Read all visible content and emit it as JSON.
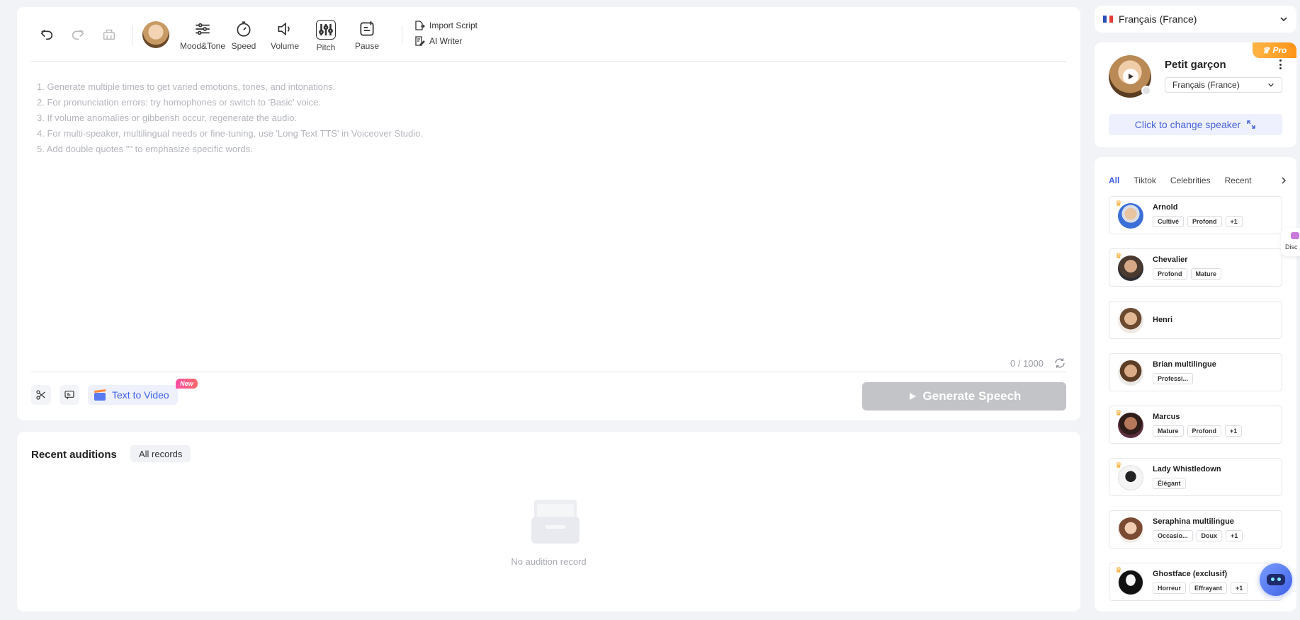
{
  "toolbar": {
    "tools": [
      "Mood&Tone",
      "Speed",
      "Volume",
      "Pitch",
      "Pause"
    ],
    "import_script": "Import Script",
    "ai_writer": "AI Writer"
  },
  "editor": {
    "tips": [
      "1. Generate multiple times to get varied emotions, tones, and intonations.",
      "2. For pronunciation errors: try homophones or switch to 'Basic' voice.",
      "3. If volume anomalies or gibberish occur, regenerate the audio.",
      "4. For multi-speaker, multilingual needs or fine-tuning, use 'Long Text TTS' in Voiceover Studio.",
      "5. Add double quotes \"\" to emphasize specific words."
    ],
    "counter": "0 / 1000",
    "text_to_video": "Text to Video",
    "new_badge": "New",
    "generate": "Generate Speech"
  },
  "recent": {
    "title": "Recent auditions",
    "all_records": "All records",
    "empty": "No audition record"
  },
  "language": {
    "selected": "Français (France)"
  },
  "speaker": {
    "pro": "Pro",
    "name": "Petit garçon",
    "language": "Français (France)",
    "change": "Click to change speaker"
  },
  "voice_tabs": [
    "All",
    "Tiktok",
    "Celebrities",
    "Recent"
  ],
  "voices": [
    {
      "name": "Arnold",
      "tags": [
        "Cultivé",
        "Profond",
        "+1"
      ],
      "crown": true
    },
    {
      "name": "Chevalier",
      "tags": [
        "Profond",
        "Mature"
      ],
      "crown": true
    },
    {
      "name": "Henri",
      "tags": [],
      "crown": false
    },
    {
      "name": "Brian multilingue",
      "tags": [
        "Professi..."
      ],
      "crown": false
    },
    {
      "name": "Marcus",
      "tags": [
        "Mature",
        "Profond",
        "+1"
      ],
      "crown": true
    },
    {
      "name": "Lady Whistledown",
      "tags": [
        "Élégant"
      ],
      "crown": true
    },
    {
      "name": "Seraphina multilingue",
      "tags": [
        "Occasio...",
        "Doux",
        "+1"
      ],
      "crown": false
    },
    {
      "name": "Ghostface (exclusif)",
      "tags": [
        "Horreur",
        "Effrayant",
        "+1"
      ],
      "crown": true
    }
  ],
  "side_tab": "Disc",
  "colors": {
    "accent": "#3e61e6",
    "pro": "#ff9f2a",
    "disabled_button": "#c3c4c7",
    "new_badge": "#ff4fa4"
  }
}
